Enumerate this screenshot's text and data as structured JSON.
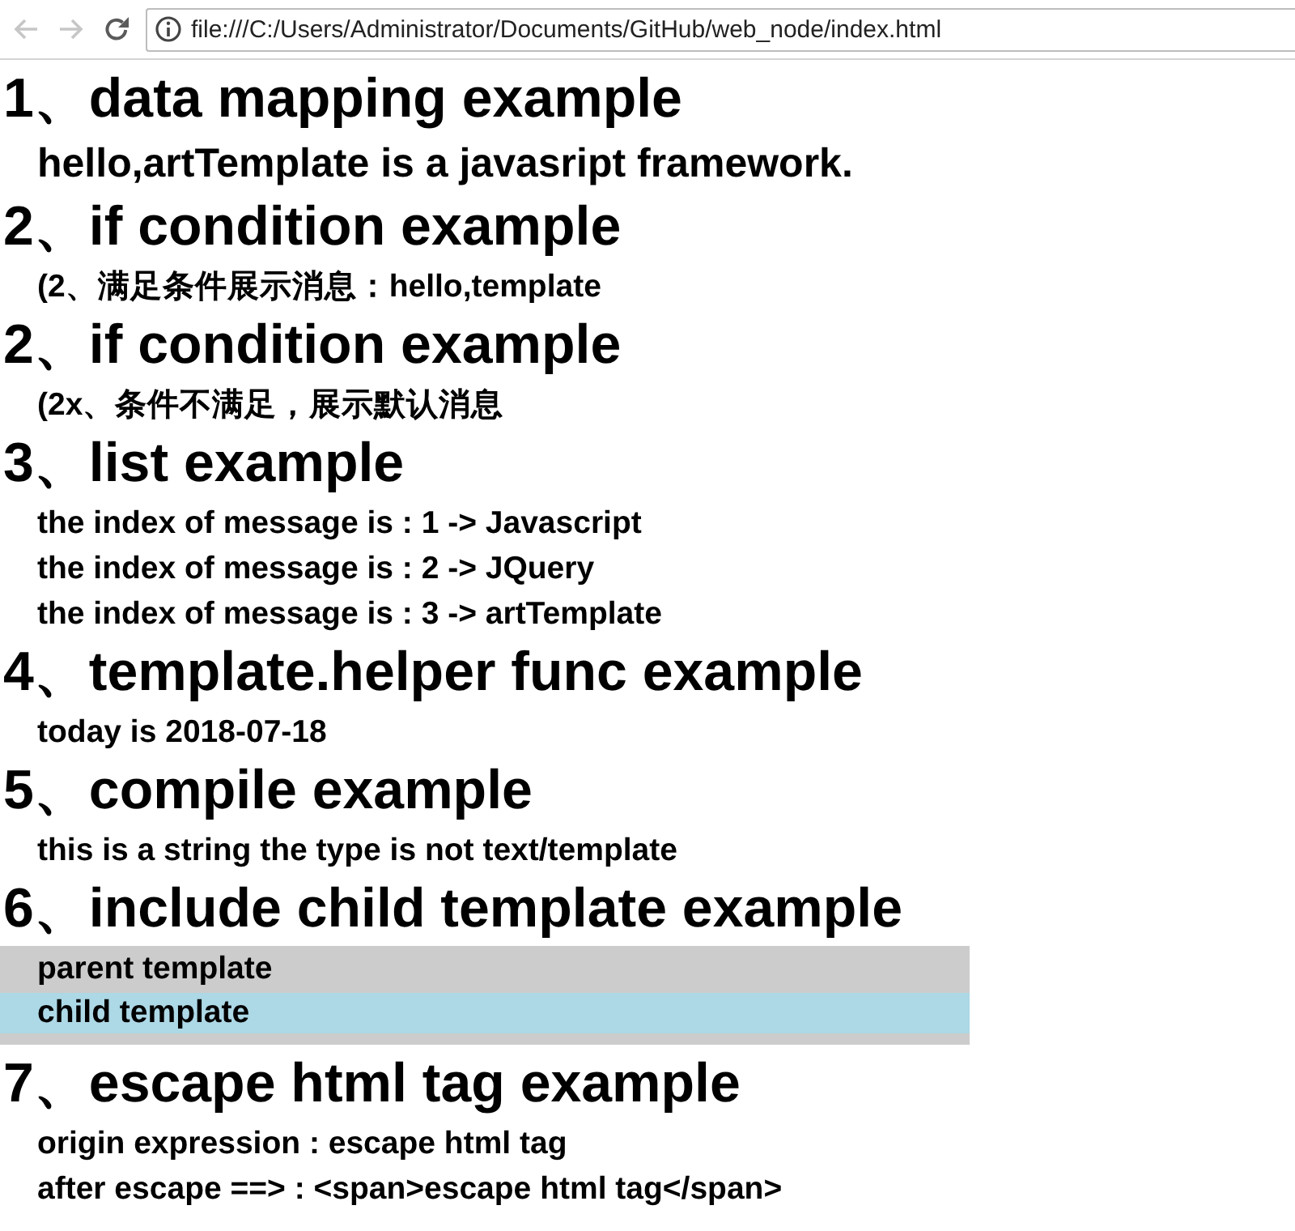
{
  "nav_buttons": [
    {
      "kind": "back",
      "disabled": true
    },
    {
      "kind": "forward",
      "disabled": true
    },
    {
      "kind": "reload",
      "disabled": false
    }
  ],
  "address_bar": {
    "url": "file:///C:/Users/Administrator/Documents/GitHub/web_node/index.html"
  },
  "sections": [
    {
      "heading": "1、data mapping example",
      "kind": "lead",
      "lines": [
        "hello,artTemplate is a javasript framework."
      ]
    },
    {
      "heading": "2、if condition example",
      "kind": "text",
      "lines": [
        "(2、满足条件展示消息：hello,template"
      ]
    },
    {
      "heading": "2、if condition example",
      "kind": "text",
      "lines": [
        "(2x、条件不满足，展示默认消息"
      ]
    },
    {
      "heading": "3、list example",
      "kind": "text",
      "lines": [
        "the index of message is : 1 -> Javascript",
        "the index of message is : 2 -> JQuery",
        "the index of message is : 3 -> artTemplate"
      ]
    },
    {
      "heading": "4、template.helper func example",
      "kind": "text",
      "lines": [
        "today is 2018-07-18"
      ]
    },
    {
      "heading": "5、compile example",
      "kind": "text",
      "lines": [
        "this is a string the type is not text/template"
      ]
    },
    {
      "heading": "6、include child template example",
      "kind": "include",
      "parent": "parent template",
      "child": "child template"
    },
    {
      "heading": "7、escape html tag example",
      "kind": "text",
      "lines": [
        "origin expression : escape html tag",
        "after escape ==> : <span>escape html tag</span>"
      ]
    }
  ]
}
